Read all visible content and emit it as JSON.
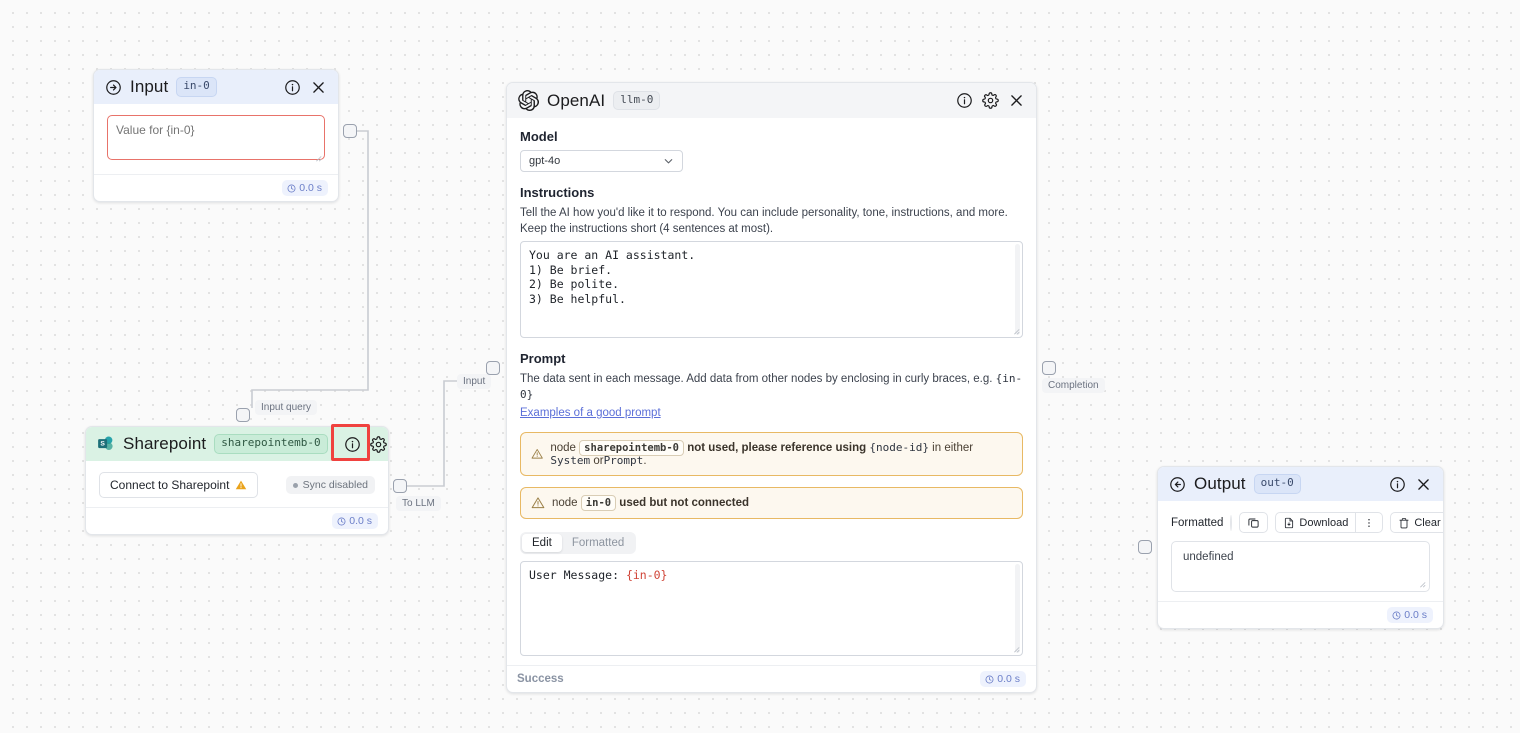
{
  "canvas": {
    "edge_labels": [
      {
        "text": "Input query"
      },
      {
        "text": "Input"
      },
      {
        "text": "To LLM"
      },
      {
        "text": "Completion"
      }
    ]
  },
  "input_node": {
    "title": "Input",
    "id": "in-0",
    "icon": "arrow-right-circle-icon",
    "textarea_placeholder": "Value for {in-0}",
    "textarea_value": "",
    "time_badge": "0.0 s",
    "info_icon": "info-icon",
    "close_icon": "close-icon"
  },
  "llm_node": {
    "title": "OpenAI",
    "id": "llm-0",
    "icon": "openai-logo-icon",
    "info_icon": "info-icon",
    "gear_icon": "gear-icon",
    "close_icon": "close-icon",
    "model_label": "Model",
    "model_value": "gpt-4o",
    "instructions_label": "Instructions",
    "instructions_help_line1": "Tell the AI how you'd like it to respond. You can include personality, tone, instructions, and more.",
    "instructions_help_line2": "Keep the instructions short (4 sentences at most).",
    "instructions_value": "You are an AI assistant.\n1) Be brief.\n2) Be polite.\n3) Be helpful.",
    "prompt_label": "Prompt",
    "prompt_help_prefix": "The data sent in each message. Add data from other nodes by enclosing in curly braces, e.g. ",
    "prompt_help_token": "{in-0}",
    "prompt_help_link": "Examples of a good prompt",
    "warning_1": {
      "icon": "warning-triangle-icon",
      "prefix": "node",
      "tag": "sharepointemb-0",
      "middle": "not used, please reference using",
      "token": "{node-id}",
      "middle2": "in either",
      "token2": "System",
      "middle3": "or",
      "token3": "Prompt",
      "suffix": "."
    },
    "warning_2": {
      "icon": "warning-triangle-icon",
      "prefix": "node",
      "tag": "in-0",
      "text": "used but not connected"
    },
    "tabs": [
      {
        "label": "Edit",
        "active": true
      },
      {
        "label": "Formatted",
        "active": false
      }
    ],
    "prompt_value_plain": "User Message: ",
    "prompt_value_token": "{in-0}",
    "status": "Success",
    "time_badge": "0.0 s"
  },
  "sharepoint_node": {
    "title": "Sharepoint",
    "id": "sharepointemb-0",
    "icon": "sharepoint-logo-icon",
    "info_icon": "info-icon",
    "gear_icon": "gear-icon",
    "close_icon": "close-icon",
    "connect_button": "Connect to Sharepoint",
    "connect_warning_icon": "warning-triangle-icon",
    "sync_status": "Sync disabled",
    "time_badge": "0.0 s"
  },
  "output_node": {
    "title": "Output",
    "id": "out-0",
    "icon": "arrow-left-circle-icon",
    "info_icon": "info-icon",
    "close_icon": "close-icon",
    "formatted_label": "Formatted",
    "formatted_toggle": "toggle-off",
    "copy_icon": "copy-icon",
    "download_label": "Download",
    "download_icon": "download-file-icon",
    "more_icon": "more-vertical-icon",
    "clear_label": "Clear",
    "clear_icon": "trash-icon",
    "content": "undefined",
    "time_badge": "0.0 s"
  },
  "colors": {
    "accent_blue": "#e9effb",
    "accent_green": "#daf2e4",
    "warning_border": "#e8b964",
    "warning_bg": "#fdf8ef",
    "error_red": "#e8736a",
    "highlight_red": "#f0423f"
  }
}
